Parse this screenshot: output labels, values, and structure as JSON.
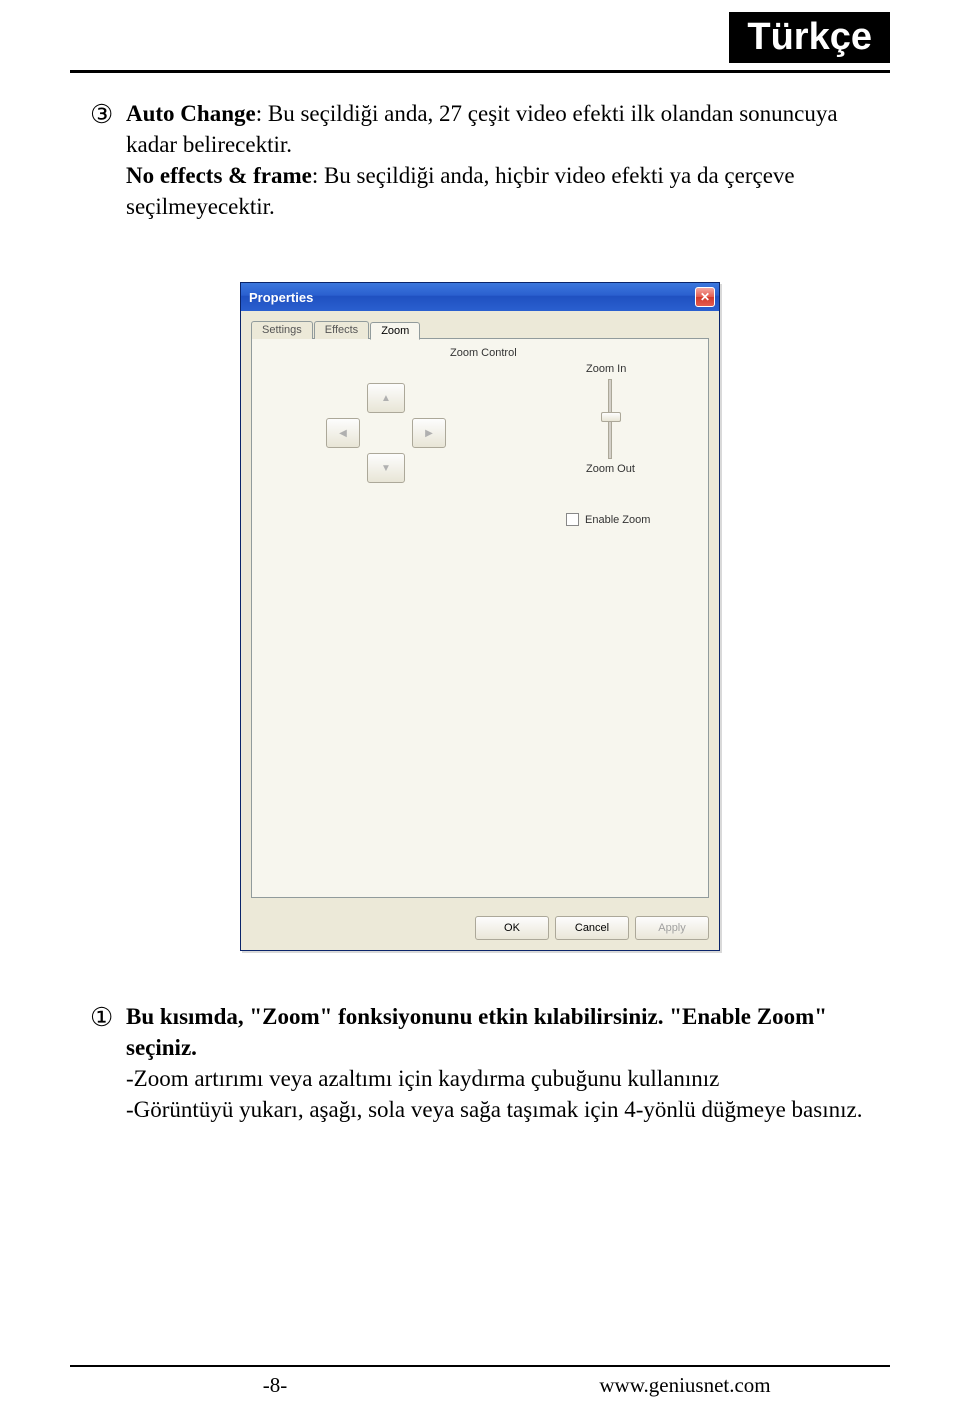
{
  "header": {
    "language_badge": "Türkçe"
  },
  "items": {
    "three": {
      "marker": "③",
      "line1_bold": "Auto Change",
      "line1_rest": ": Bu seçildiği anda, 27 çeşit video efekti ilk olandan sonuncuya kadar belirecektir.",
      "line2_bold": "No effects & frame",
      "line2_rest": ": Bu seçildiği anda, hiçbir video efekti ya da çerçeve seçilmeyecektir."
    },
    "one": {
      "marker": "①",
      "line1_bold": "Bu kısımda, \"Zoom\" fonksiyonunu etkin kılabilirsiniz. \"Enable Zoom\" seçiniz.",
      "line2": "-Zoom artırımı veya azaltımı için kaydırma çubuğunu kullanınız",
      "line3": "-Görüntüyü yukarı, aşağı, sola veya sağa taşımak için 4-yönlü düğmeye basınız."
    }
  },
  "dialog": {
    "title": "Properties",
    "tabs": {
      "settings": "Settings",
      "effects": "Effects",
      "zoom": "Zoom"
    },
    "zoom_control_label": "Zoom Control",
    "zoom_in_label": "Zoom In",
    "zoom_out_label": "Zoom Out",
    "enable_zoom_label": "Enable Zoom",
    "buttons": {
      "ok": "OK",
      "cancel": "Cancel",
      "apply": "Apply"
    },
    "arrows": {
      "up": "▲",
      "down": "▼",
      "left": "◀",
      "right": "▶"
    }
  },
  "footer": {
    "page": "-8-",
    "url": "www.geniusnet.com"
  }
}
